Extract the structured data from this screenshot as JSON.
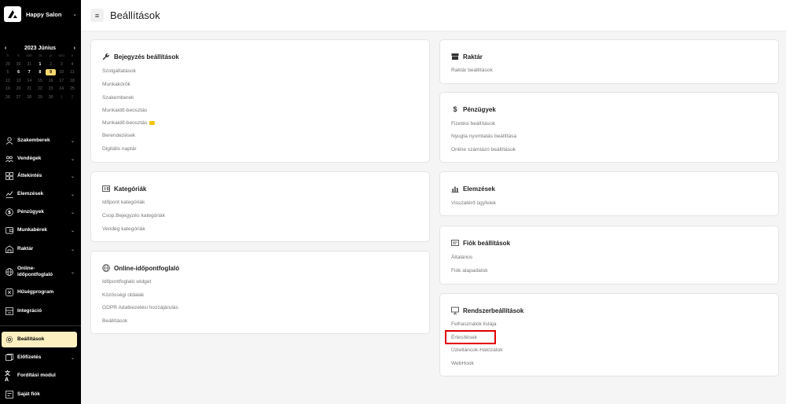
{
  "brand": {
    "name": "Happy Salon"
  },
  "calendar": {
    "title": "2023 Június",
    "weekdays": [
      "h",
      "k",
      "sze",
      "cs",
      "p",
      "szo",
      "v"
    ],
    "rows": [
      [
        "29",
        "30",
        "31",
        "1",
        "2",
        "3",
        "4"
      ],
      [
        "5",
        "6",
        "7",
        "8",
        "9",
        "10",
        "11"
      ],
      [
        "12",
        "13",
        "14",
        "15",
        "16",
        "17",
        "18"
      ],
      [
        "19",
        "20",
        "21",
        "22",
        "23",
        "24",
        "25"
      ],
      [
        "26",
        "27",
        "28",
        "29",
        "30",
        "1",
        "2"
      ]
    ]
  },
  "sidebar": {
    "items": [
      {
        "label": "Szakemberek"
      },
      {
        "label": "Vendégek"
      },
      {
        "label": "Áttekintés"
      },
      {
        "label": "Elemzések"
      },
      {
        "label": "Pénzügyek"
      },
      {
        "label": "Munkabérek"
      },
      {
        "label": "Raktár"
      },
      {
        "label": "Online-\nidőpontfoglaló"
      },
      {
        "label": "Hűségprogram"
      },
      {
        "label": "Integráció"
      },
      {
        "label": "Beállítások"
      },
      {
        "label": "Előfizetés"
      },
      {
        "label": "Fordítási modul"
      },
      {
        "label": "Saját fiók"
      }
    ]
  },
  "header": {
    "title": "Beállítások"
  },
  "cards": {
    "bejegyzes": {
      "title": "Bejegyzés beállítások",
      "links": [
        "Szolgáltatások",
        "Munkakörök",
        "Szakemberek",
        "Munkaidő-beosztás",
        "Munkaidő-beosztás",
        "Berendezések",
        "Digitális naptár"
      ]
    },
    "kategoriak": {
      "title": "Kategóriák",
      "links": [
        "Időpont kategóriák",
        "Csop.Bejegyzés kategóriák",
        "Vendég kategóriák"
      ]
    },
    "online": {
      "title": "Online-időpontfoglaló",
      "links": [
        "Időpontfoglaló widget",
        "Közösségi oldalak",
        "GDPR Adatkezelési hozzájárulás",
        "Beállítások"
      ]
    },
    "raktar": {
      "title": "Raktár",
      "links": [
        "Raktár beállítások"
      ]
    },
    "penzugyek": {
      "title": "Pénzügyek",
      "links": [
        "Fizetési beállítások",
        "Nyugta nyomtatás beállítása",
        "Online számlázó beállítások"
      ]
    },
    "elemzesek": {
      "title": "Elemzések",
      "links": [
        "Visszatérő ügyfelek"
      ]
    },
    "fiok": {
      "title": "Fiók beállítások",
      "links": [
        "Általános",
        "Fiók alapadatok"
      ]
    },
    "rendszer": {
      "title": "Rendszerbeállítások",
      "links": [
        "Felhasználók listája",
        "Értesítések",
        "Üzletláncok-Hálózatok",
        "WebHook"
      ]
    }
  },
  "colors": {
    "accent": "#f5d76e",
    "active_bg": "#fcefc0",
    "highlight": "#e00000",
    "sidebar_bg": "#000000"
  }
}
